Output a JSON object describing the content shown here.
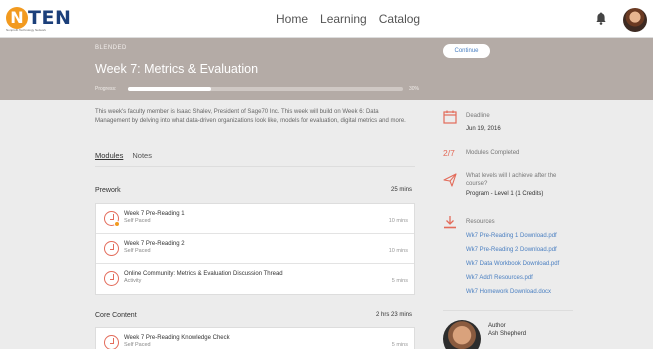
{
  "brand": {
    "wordmark": "TEN",
    "mark_letter": "N",
    "tagline": "Nonprofit Technology Network",
    "colors": {
      "orange": "#f29a1f",
      "navy": "#1b3f7a"
    }
  },
  "nav": {
    "links": [
      "Home",
      "Learning",
      "Catalog"
    ],
    "icons": [
      "bell-icon",
      "avatar"
    ]
  },
  "hero": {
    "kicker": "BLENDED",
    "title": "Week 7: Metrics & Evaluation",
    "progress_label": "Progress:",
    "progress_percent": 30,
    "progress_text": "30%",
    "continue_label": "Continue",
    "background_color": "#b4aba6"
  },
  "intro_text": "This week's faculty member is Isaac Shalev, President of Sage70 Inc. This week will build on Week 6: Data Management by delving into what data-driven organizations look like, models for evaluation, digital metrics and more.",
  "tabs": [
    {
      "label": "Modules",
      "active": true
    },
    {
      "label": "Notes",
      "active": false
    }
  ],
  "sections": [
    {
      "title": "Prework",
      "duration": "25 mins",
      "items": [
        {
          "title": "Week 7 Pre-Reading 1",
          "subtitle": "Self Paced",
          "duration": "10 mins",
          "icon": "check-circle-icon"
        },
        {
          "title": "Week 7 Pre-Reading 2",
          "subtitle": "Self Paced",
          "duration": "10 mins",
          "icon": "check-circle-icon"
        },
        {
          "title": "Online Community: Metrics & Evaluation Discussion Thread",
          "subtitle": "Activity",
          "duration": "5 mins",
          "icon": "activity-icon"
        }
      ]
    },
    {
      "title": "Core Content",
      "duration": "2 hrs 23 mins",
      "items": [
        {
          "title": "Week 7 Pre-Reading Knowledge Check",
          "subtitle": "Self Paced",
          "duration": "5 mins",
          "icon": "quiz-icon"
        }
      ]
    }
  ],
  "sidebar": {
    "deadline_label": "Deadline",
    "deadline_value": "Jun 19, 2016",
    "modules_fraction": "2/7",
    "modules_label": "Modules Completed",
    "achieve_label_1": "What levels will I achieve after the",
    "achieve_label_2": "course?",
    "achieve_value": "Program - Level 1 (1 Credits)",
    "resources_label": "Resources",
    "resources": [
      "Wk7 Pre-Reading 1 Download.pdf",
      "Wk7 Pre-Reading 2 Download.pdf",
      "Wk7 Data Workbook Download.pdf",
      "Wk7 Add'l Resources.pdf",
      "Wk7 Homework Download.docx"
    ],
    "author_label": "Author",
    "author_name": "Ash Shepherd",
    "accent_color": "#e36b5a",
    "link_color": "#4a7fc1"
  }
}
